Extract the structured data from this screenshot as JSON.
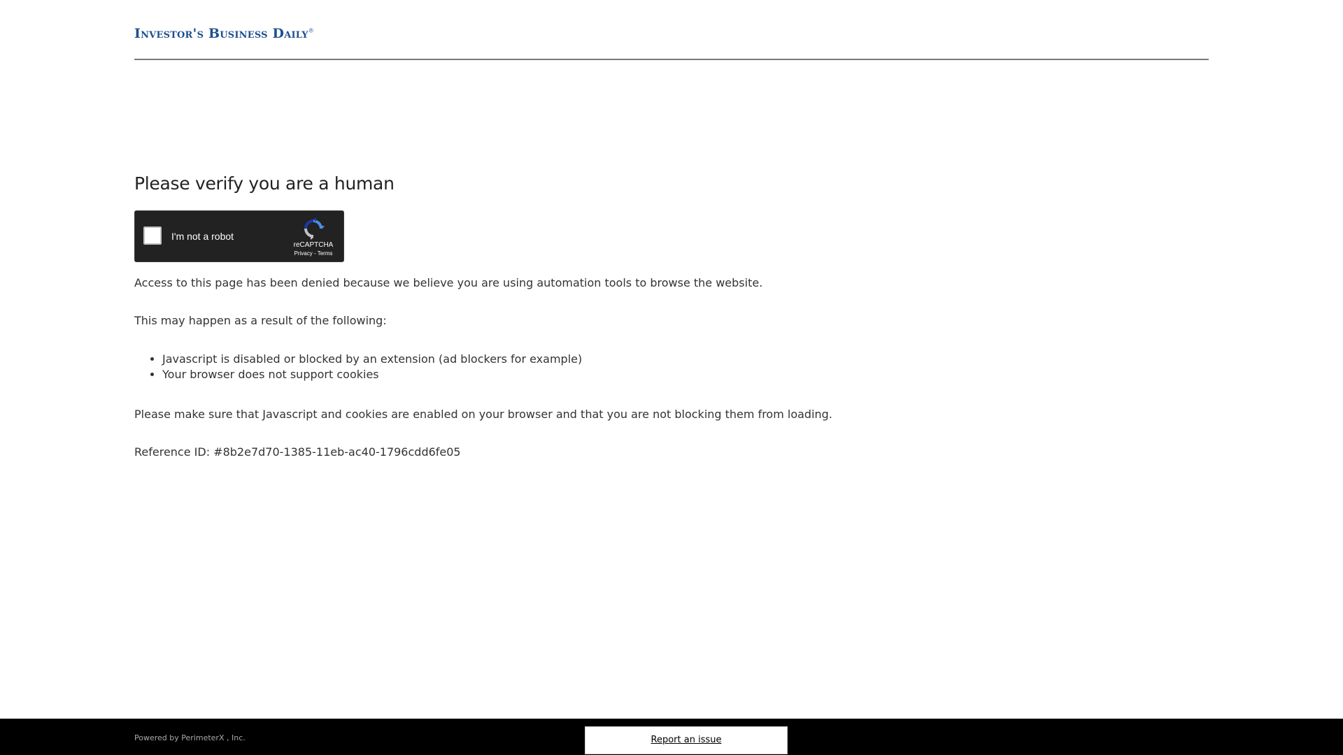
{
  "header": {
    "logo_text": "Investor's Business Daily",
    "logo_mark": "®"
  },
  "main": {
    "title": "Please verify you are a human",
    "captcha": {
      "label": "I'm not a robot",
      "brand": "reCAPTCHA",
      "privacy": "Privacy",
      "separator": " - ",
      "terms": "Terms",
      "checked": false
    },
    "message": "Access to this page has been denied because we believe you are using automation tools to browse the website.",
    "reasons_intro": "This may happen as a result of the following:",
    "reasons": [
      "Javascript is disabled or blocked by an extension (ad blockers for example)",
      "Your browser does not support cookies"
    ],
    "instructions": "Please make sure that Javascript and cookies are enabled on your browser and that you are not blocking them from loading.",
    "reference": "Reference ID: #8b2e7d70-1385-11eb-ac40-1796cdd6fe05"
  },
  "footer": {
    "powered_prefix": "Powered by ",
    "powered_vendor": "PerimeterX",
    "powered_suffix": " , Inc.",
    "report_label": "Report an issue"
  },
  "colors": {
    "brand": "#1d4f91",
    "captcha_bg": "#222222",
    "footer_bg": "#000000"
  },
  "icons": {
    "captcha": "recaptcha-logo-icon"
  }
}
